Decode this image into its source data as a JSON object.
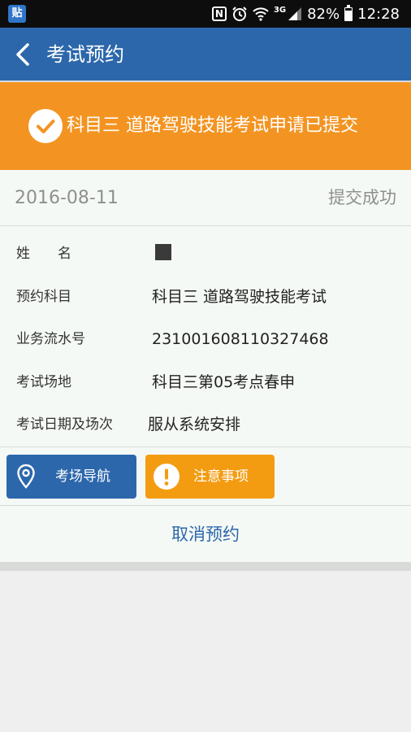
{
  "status_bar": {
    "app_icon": "贴",
    "battery": "82%",
    "time": "12:28",
    "network": "3G",
    "icons": [
      "nfc-icon",
      "alarm-icon",
      "wifi-icon",
      "signal-icon",
      "battery-icon"
    ]
  },
  "header": {
    "title": "考试预约",
    "back_icon": "chevron-left-icon"
  },
  "banner": {
    "message": "科目三 道路驾驶技能考试申请已提交",
    "icon": "check-circle-icon"
  },
  "submission": {
    "date": "2016-08-11",
    "status": "提交成功"
  },
  "details": [
    {
      "label": "姓　　名",
      "value": ""
    },
    {
      "label": "预约科目",
      "value": "科目三 道路驾驶技能考试"
    },
    {
      "label": "业务流水号",
      "value": "231001608110327468"
    },
    {
      "label": "考试场地",
      "value": "科目三第05考点春申"
    },
    {
      "label": "考试日期及场次",
      "value": "服从系统安排"
    }
  ],
  "actions": {
    "navigation_label": "考场导航",
    "notice_label": "注意事项",
    "cancel_label": "取消预约"
  },
  "colors": {
    "header": "#2c67ab",
    "banner": "#f39422",
    "notice_button": "#f39c12",
    "card_background": "#f5f9f5"
  }
}
